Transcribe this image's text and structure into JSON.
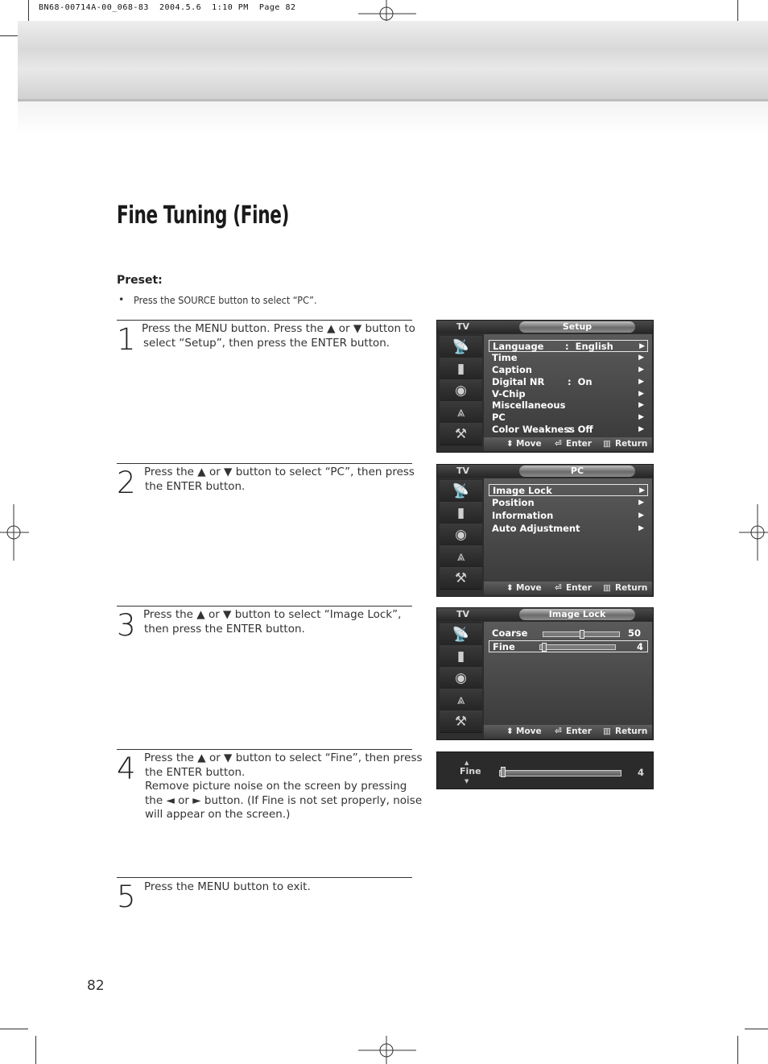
{
  "print_info": "BN68-00714A-00_068-83  2004.5.6  1:10 PM  Page 82",
  "title": "Fine Tuning (Fine)",
  "preset": {
    "label": "Preset:",
    "bullet": "•",
    "text": "Press the SOURCE button to select “PC”."
  },
  "steps": [
    {
      "num": "1",
      "lines": [
        "Press the MENU button. Press the ▲ or ▼ button to",
        "select “Setup”, then press the ENTER button."
      ]
    },
    {
      "num": "2",
      "lines": [
        "Press the ▲ or ▼ button to select “PC”, then press",
        "the ENTER button."
      ]
    },
    {
      "num": "3",
      "lines": [
        "Press the ▲ or ▼ button to select “Image Lock”,",
        "then press the ENTER button."
      ]
    },
    {
      "num": "4",
      "lines": [
        "Press the ▲ or ▼ button to select “Fine”, then press",
        "the ENTER button.",
        "Remove picture noise on the screen by pressing",
        "the ◄ or ► button. (If Fine is not set properly, noise",
        "will appear on the screen.)"
      ]
    },
    {
      "num": "5",
      "lines": [
        "Press the MENU button to exit."
      ]
    }
  ],
  "osd_common": {
    "tv_label": "TV",
    "move": "Move",
    "enter": "Enter",
    "return": "Return",
    "arrow": "▶",
    "colon": ":"
  },
  "osd_setup": {
    "title": "Setup",
    "items": [
      {
        "label": "Language",
        "value": "English"
      },
      {
        "label": "Time",
        "value": ""
      },
      {
        "label": "Caption",
        "value": ""
      },
      {
        "label": "Digital NR",
        "value": "On"
      },
      {
        "label": "V-Chip",
        "value": ""
      },
      {
        "label": "Miscellaneous",
        "value": ""
      },
      {
        "label": "PC",
        "value": ""
      },
      {
        "label": "Color Weakness",
        "value": "Off"
      }
    ]
  },
  "osd_pc": {
    "title": "PC",
    "items": [
      {
        "label": "Image Lock"
      },
      {
        "label": "Position"
      },
      {
        "label": "Information"
      },
      {
        "label": "Auto Adjustment"
      }
    ]
  },
  "osd_imagelock": {
    "title": "Image Lock",
    "items": [
      {
        "label": "Coarse",
        "value": "50",
        "level": 0.5
      },
      {
        "label": "Fine",
        "value": "4",
        "level": 0.04
      }
    ]
  },
  "fine_bar": {
    "label": "Fine",
    "value": "4",
    "level": 0.04
  },
  "page_number": "82",
  "icons": [
    "satellite-dish-icon",
    "speaker-icon",
    "sound-disc-icon",
    "channel-antenna-icon",
    "setup-tools-icon"
  ]
}
